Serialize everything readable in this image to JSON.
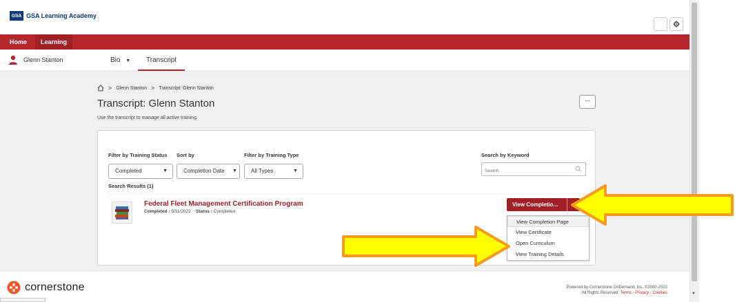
{
  "brand": {
    "logo_abbr": "GSA",
    "name": "GSA Learning Academy"
  },
  "nav": {
    "home": "Home",
    "learning": "Learning"
  },
  "subnav": {
    "user": "Glenn Stanton",
    "bio": "Bio",
    "transcript": "Transcript"
  },
  "breadcrumb": {
    "crumb1": "Glenn Stanton",
    "crumb2": "Transcript: Glenn Stanton"
  },
  "page": {
    "title": "Transcript: Glenn Stanton",
    "description": "Use the transcript to manage all active training.",
    "more": "···"
  },
  "filters": {
    "status_label": "Filter by Training Status",
    "status_value": "Completed",
    "sort_label": "Sort by",
    "sort_value": "Completion Date",
    "type_label": "Filter by Training Type",
    "type_value": "All Types",
    "keyword_label": "Search by Keyword",
    "keyword_placeholder": "Search"
  },
  "results": {
    "label": "Search Results (1)",
    "item": {
      "title": "Federal Fleet Management Certification Program",
      "completed_label": "Completed :",
      "completed_date": "5/11/2022",
      "status_label": "Status :",
      "status_value": "Completed"
    }
  },
  "action": {
    "button": "View Completio...",
    "options": [
      "View Completion Page",
      "View Certificate",
      "Open Curriculum",
      "View Training Details"
    ]
  },
  "footer": {
    "brand": "cornerstone",
    "powered": "Powered by Cornerstone OnDemand, Inc. ©2000-2022",
    "rights": "All Rights Reserved.",
    "terms": "Terms",
    "privacy": "Privacy",
    "cookies": "Cookies"
  },
  "colors": {
    "brand_red": "#b5272d",
    "dark_red": "#a11f25",
    "arrow_yellow": "#ffff00",
    "arrow_orange": "#f79a1e"
  }
}
